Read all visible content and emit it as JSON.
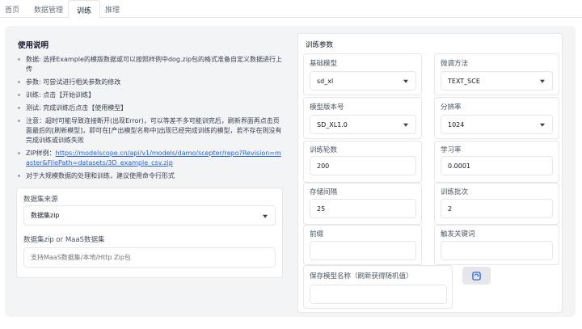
{
  "tabs": [
    "首页",
    "数据管理",
    "训练",
    "推理"
  ],
  "instructions": {
    "title": "使用说明",
    "items": [
      "数据: 选择Example的模版数据或可以按照样例中dog.zip包的格式准备自定义数据进行上传",
      "参数: 可尝试进行相关参数的修改",
      "训练: 点击【开始训练】",
      "测试: 完成训练后点击【使用模型】",
      "注意：超时可能导致连接断开(出现Error)，可以等差不多可能训完后，刷新界面再点击页面最后的[刷新模型]，即可在[产出模型名称中]出现已经完成训练的模型，若不存在则没有完成训练或训练失败"
    ],
    "zip_prefix": "ZIP样例：",
    "zip_link": "https://modelscope.cn/api/v1/models/damo/scepter/repo?Revision=master&FilePath=datasets/3D_example_csv.zip",
    "last_item": "对于大规模数据的处理和训练，建议使用命令行形式"
  },
  "data_source": {
    "label": "数据集来源",
    "value": "数据集zip",
    "zip_label": "数据集zip or MaaS数据集",
    "zip_placeholder": "支持MaaS数据集/本地/Http Zip包"
  },
  "params": {
    "title": "训练参数",
    "base_model_label": "基础模型",
    "base_model_value": "sd_xl",
    "finetune_label": "微调方法",
    "finetune_value": "TEXT_SCE",
    "version_label": "模型版本号",
    "version_value": "SD_XL1.0",
    "resolution_label": "分辨率",
    "resolution_value": "1024",
    "epochs_label": "训练轮数",
    "epochs_value": "200",
    "lr_label": "学习率",
    "lr_value": "0.0001",
    "save_interval_label": "存储间隔",
    "save_interval_value": "25",
    "batch_label": "训练批次",
    "batch_value": "2",
    "prefix_label": "前缀",
    "prefix_value": "",
    "trigger_label": "触发关键词",
    "trigger_value": "",
    "save_name_label": "保存模型名称（刷新获得随机值）",
    "save_name_value": ""
  }
}
